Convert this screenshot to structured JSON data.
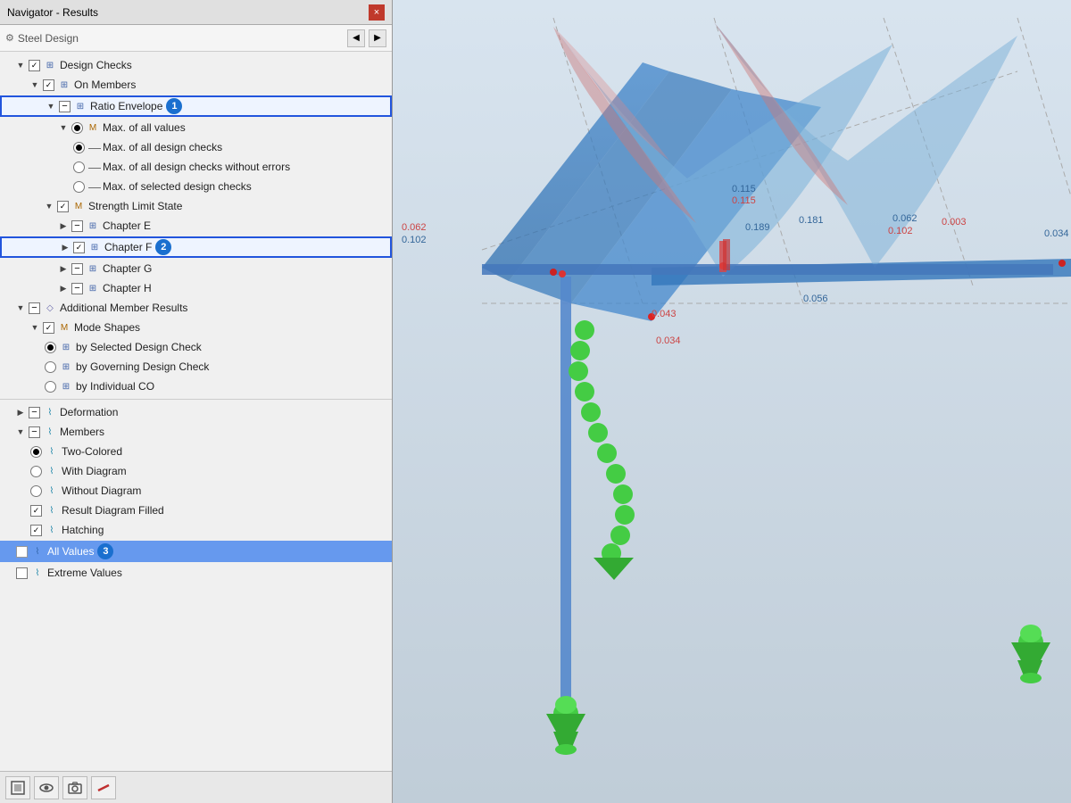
{
  "window": {
    "title": "Navigator - Results",
    "close_label": "×"
  },
  "toolbar": {
    "module_label": "Steel Design",
    "back_label": "◀",
    "forward_label": "▶"
  },
  "tree": {
    "design_checks_label": "Design Checks",
    "on_members_label": "On Members",
    "ratio_envelope_label": "Ratio Envelope",
    "max_all_values_label": "Max. of all values",
    "max_all_design_checks_label": "Max. of all design checks",
    "max_all_design_checks_no_err_label": "Max. of all design checks without errors",
    "max_selected_design_checks_label": "Max. of selected design checks",
    "strength_limit_state_label": "Strength Limit State",
    "chapter_e_label": "Chapter E",
    "chapter_f_label": "Chapter F",
    "chapter_g_label": "Chapter G",
    "chapter_h_label": "Chapter H",
    "additional_member_results_label": "Additional Member Results",
    "mode_shapes_label": "Mode Shapes",
    "by_selected_design_check_label": "by Selected Design Check",
    "by_governing_design_check_label": "by Governing Design Check",
    "by_individual_co_label": "by Individual CO",
    "deformation_label": "Deformation",
    "members_label": "Members",
    "two_colored_label": "Two-Colored",
    "with_diagram_label": "With Diagram",
    "without_diagram_label": "Without Diagram",
    "result_diagram_filled_label": "Result Diagram Filled",
    "hatching_label": "Hatching",
    "all_values_label": "All Values",
    "extreme_values_label": "Extreme Values"
  },
  "badges": {
    "b1": "1",
    "b2": "2",
    "b3": "3"
  },
  "bottom_toolbar": {
    "btn1": "🖥",
    "btn2": "👁",
    "btn3": "🎥",
    "btn4": "—"
  },
  "viewport": {
    "values": [
      "0.062",
      "0.102",
      "0.115",
      "0.115",
      "0.189",
      "0.181",
      "0.003",
      "0.034",
      "0.062",
      "0.102",
      "0.043",
      "0.034",
      "0.056"
    ]
  }
}
